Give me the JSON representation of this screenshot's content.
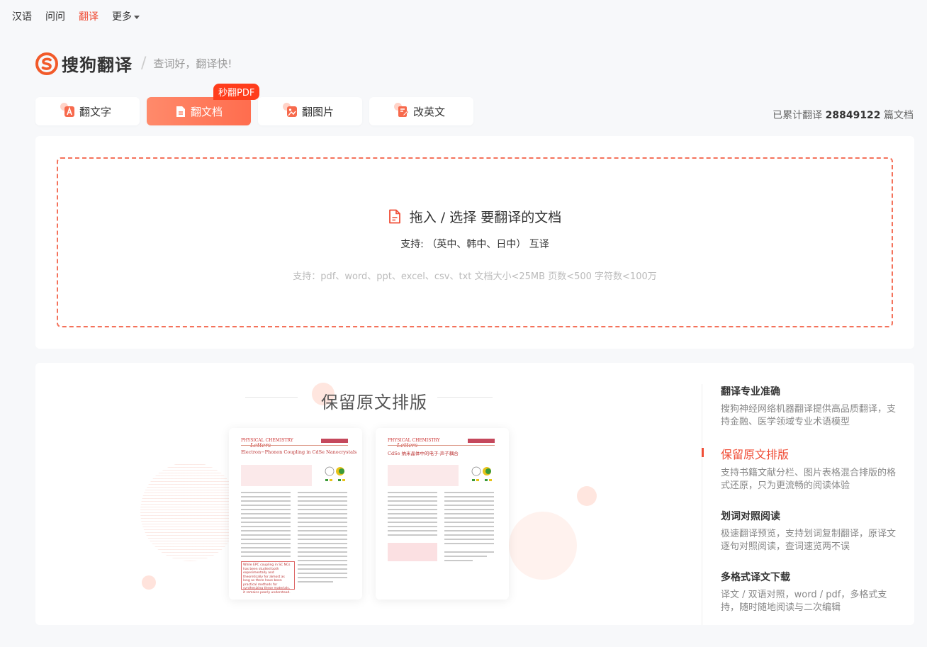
{
  "nav": {
    "items": [
      "汉语",
      "问问",
      "翻译",
      "更多"
    ],
    "active_index": 2
  },
  "logo": {
    "brand": "搜狗翻译",
    "slogan": "查词好，翻译快!"
  },
  "tabs": [
    {
      "label": "翻文字",
      "icon": "text-translate-icon"
    },
    {
      "label": "翻文档",
      "icon": "document-icon"
    },
    {
      "label": "翻图片",
      "icon": "image-icon"
    },
    {
      "label": "改英文",
      "icon": "edit-english-icon"
    }
  ],
  "active_tab": 1,
  "badge": "秒翻PDF",
  "counter": {
    "prefix": "已累计翻译",
    "count": "28849122",
    "suffix": "篇文档"
  },
  "upload": {
    "title": "拖入 / 选择 要翻译的文档",
    "languages": "支持: （英中、韩中、日中） 互译",
    "hint": "支持：pdf、word、ppt、excel、csv、txt    文档大小<25MB 页数<500 字符数<100万"
  },
  "showcase": {
    "title": "保留原文排版",
    "doc_original": {
      "journal": "Letters",
      "article_title": "Electron−Phonon Coupling in CdSe Nanocrystals",
      "quote": "While EPC coupling in SC NCs has been studied both experimentally and theoretically for almost as long as there have been practical methods for synthesizing these materials, it remains poorly understood."
    },
    "doc_translated": {
      "journal": "Letters",
      "article_title": "CdSe 纳米晶体中的电子-声子耦合"
    }
  },
  "features": [
    {
      "title": "翻译专业准确",
      "desc": "搜狗神经网络机器翻译提供高品质翻译，支持金融、医学领域专业术语模型"
    },
    {
      "title": "保留原文排版",
      "desc": "支持书籍文献分栏、图片表格混合排版的格式还原，只为更流畅的阅读体验"
    },
    {
      "title": "划词对照阅读",
      "desc": "极速翻译预览，支持划词复制翻译，原译文逐句对照阅读，查词速览两不误"
    },
    {
      "title": "多格式译文下载",
      "desc": "译文 / 双语对照，word / pdf，多格式支持，随时随地阅读与二次编辑"
    }
  ],
  "active_feature": 1,
  "colors": {
    "accent": "#f04e37",
    "tab_active_start": "#ff8a6b",
    "tab_active_end": "#ff6d4e",
    "badge": "#ff3d1c",
    "dashed_border": "#f4725b"
  }
}
